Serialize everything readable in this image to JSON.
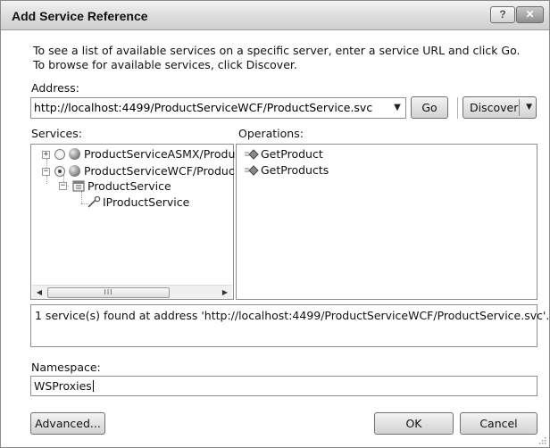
{
  "window": {
    "title": "Add Service Reference",
    "help_label": "?",
    "close_label": "✕"
  },
  "intro_text": "To see a list of available services on a specific server, enter a service URL and click Go. To browse for available services, click Discover.",
  "address": {
    "label": "Address:",
    "value": "http://localhost:4499/ProductServiceWCF/ProductService.svc",
    "go_label": "Go",
    "discover_label": "Discover"
  },
  "services": {
    "label": "Services:",
    "items": [
      {
        "label": "ProductServiceASMX/Produ",
        "selected": false,
        "expanded": false
      },
      {
        "label": "ProductServiceWCF/Produc",
        "selected": true,
        "expanded": true
      },
      {
        "label": "ProductService"
      },
      {
        "label": "IProductService"
      }
    ],
    "scroll_thumb": "III"
  },
  "operations": {
    "label": "Operations:",
    "items": [
      "GetProduct",
      "GetProducts"
    ]
  },
  "status_text": "1 service(s) found at address 'http://localhost:4499/ProductServiceWCF/ProductService.svc'.",
  "namespace": {
    "label": "Namespace:",
    "value": "WSProxies"
  },
  "buttons": {
    "advanced": "Advanced...",
    "ok": "OK",
    "cancel": "Cancel"
  }
}
